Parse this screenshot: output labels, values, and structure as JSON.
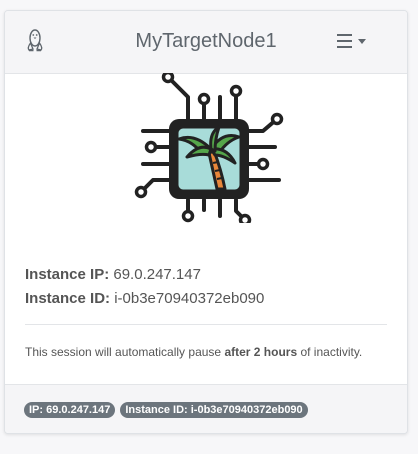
{
  "header": {
    "os_icon": "linux-penguin-icon",
    "title": "MyTargetNode1",
    "menu_icon": "hamburger-menu-icon"
  },
  "logo": {
    "icon": "cpu-chip-palm-tree-logo"
  },
  "instance": {
    "ip_label": "Instance IP:",
    "ip_value": "69.0.247.147",
    "id_label": "Instance ID:",
    "id_value": "i-0b3e70940372eb090"
  },
  "session": {
    "prefix": "This session will automatically pause",
    "duration": "after 2 hours",
    "suffix": "of inactivity."
  },
  "footer": {
    "ip_badge": "IP: 69.0.247.147",
    "id_badge": "Instance ID: i-0b3e70940372eb090"
  },
  "colors": {
    "chip_fill": "#a8dcd9",
    "trunk": "#e8873a",
    "leaves": "#55a64b",
    "outline": "#222222",
    "badge": "#6c757d"
  }
}
